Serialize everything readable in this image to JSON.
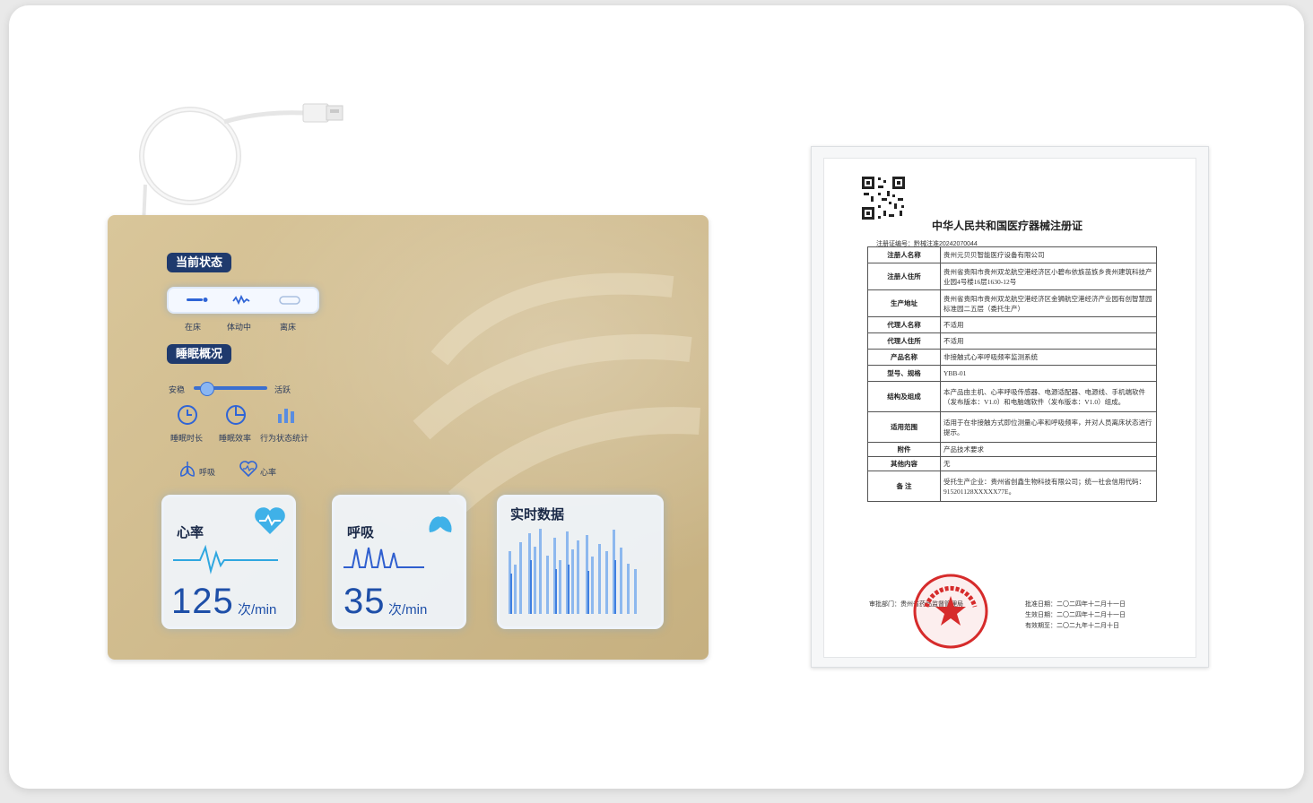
{
  "mat": {
    "current_state_label": "当前状态",
    "states": [
      "在床",
      "体动中",
      "离床"
    ],
    "sleep_overview_label": "睡眠概况",
    "slider_left": "安稳",
    "slider_right": "活跃",
    "stats": [
      "睡眠时长",
      "睡眠效率",
      "行为状态统计"
    ],
    "toggles": [
      "呼吸",
      "心率"
    ],
    "heart": {
      "title": "心率",
      "value": "125",
      "unit": "次/min"
    },
    "breath": {
      "title": "呼吸",
      "value": "35",
      "unit": "次/min"
    },
    "realtime": {
      "title": "实时数据"
    }
  },
  "certificate": {
    "title": "中华人民共和国医疗器械注册证",
    "number": "注册证编号：黔械注准20242070044",
    "rows": [
      {
        "key": "注册人名称",
        "value": "贵州元贝贝智能医疗设备有限公司"
      },
      {
        "key": "注册人住所",
        "value": "贵州省贵阳市贵州双龙航空港经济区小碧布依族苗族乡贵州建筑科技产业园4号楼16层1630-12号"
      },
      {
        "key": "生产地址",
        "value": "贵州省贵阳市贵州双龙航空港经济区金狮航空港经济产业园有创智慧园标准园二五层（委托生产）"
      },
      {
        "key": "代理人名称",
        "value": "不适用"
      },
      {
        "key": "代理人住所",
        "value": "不适用"
      },
      {
        "key": "产品名称",
        "value": "非接触式心率呼吸频率监测系统"
      },
      {
        "key": "型号、规格",
        "value": "YBB-01"
      },
      {
        "key": "结构及组成",
        "value": "本产品由主机、心率呼吸传感器、电源适配器、电源线、手机端软件（发布版本：V1.0）和电脑端软件（发布版本：V1.0）组成。"
      },
      {
        "key": "适用范围",
        "value": "适用于在非接触方式即位测量心率和呼吸频率，并对人员离床状态进行提示。"
      },
      {
        "key": "附件",
        "value": "产品技术要求"
      },
      {
        "key": "其他内容",
        "value": "无"
      },
      {
        "key": "备 注",
        "value": "受托生产企业：贵州省创鑫生物科技有限公司；统一社会信用代码：915201128XXXXX77E。"
      }
    ],
    "approval_dept": "审批部门：贵州省药品监督管理局",
    "dates": [
      "批准日期：二〇二四年十二月十一日",
      "生效日期：二〇二四年十二月十一日",
      "有效期至：二〇二九年十二月十日"
    ],
    "seal_text": "贵州省药品监督管理局"
  }
}
